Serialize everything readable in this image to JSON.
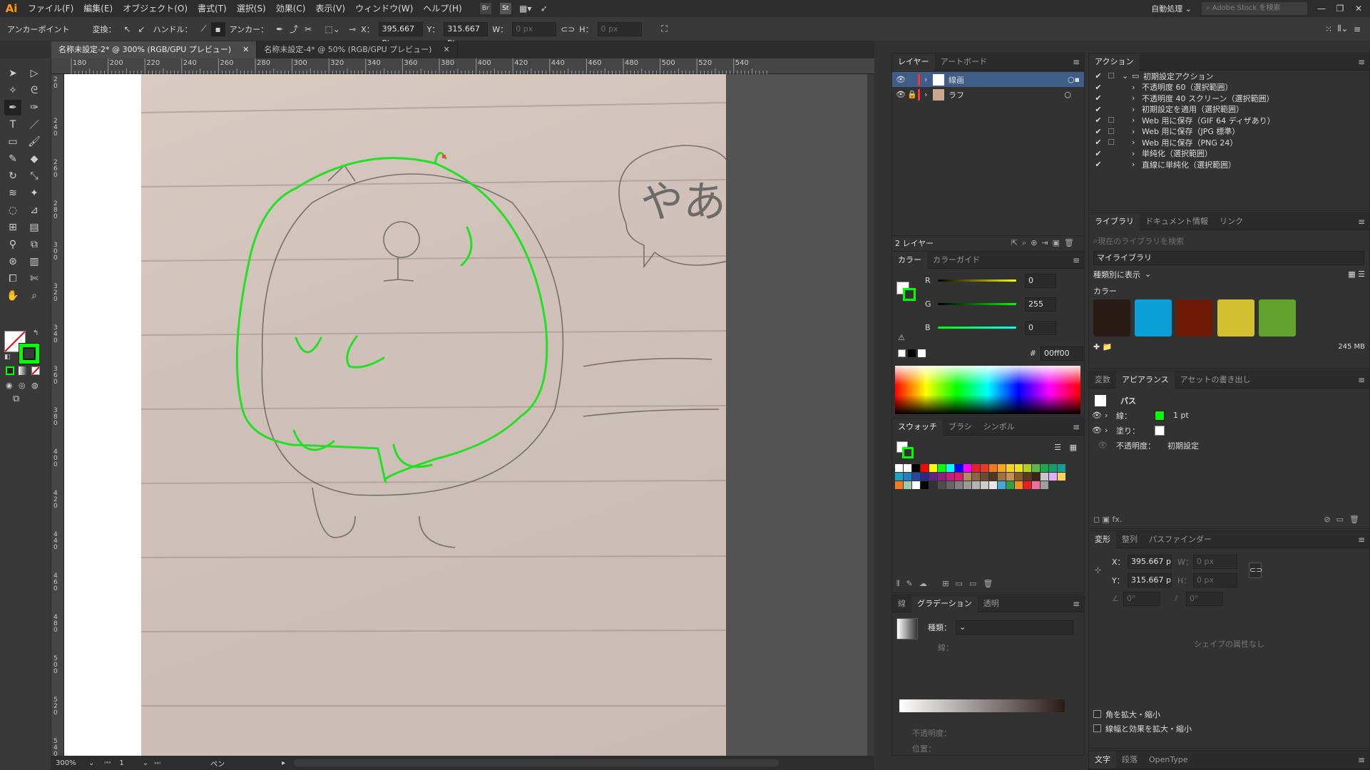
{
  "app": {
    "logo": "Ai",
    "menus": [
      "ファイル(F)",
      "編集(E)",
      "オブジェクト(O)",
      "書式(T)",
      "選択(S)",
      "効果(C)",
      "表示(V)",
      "ウィンドウ(W)",
      "ヘルプ(H)"
    ],
    "workspace": "自動処理",
    "stock_placeholder": "Adobe Stock を検索",
    "st": "St"
  },
  "control": {
    "mode": "アンカーポイント",
    "convert": "変換：",
    "handle": "ハンドル：",
    "anchor": "アンカー：",
    "x_label": "X：",
    "x_value": "395.667 p:",
    "y_label": "Y：",
    "y_value": "315.667 p:",
    "w_label": "W：",
    "w_value": "0 px",
    "h_label": "H：",
    "h_value": "0 px"
  },
  "tabs": [
    {
      "label": "名称未設定-2* @ 300% (RGB/GPU プレビュー)"
    },
    {
      "label": "名称未設定-4* @ 50% (RGB/GPU プレビュー)"
    }
  ],
  "ruler_h": [
    "180",
    "200",
    "220",
    "240",
    "260",
    "280",
    "300",
    "320",
    "340",
    "360",
    "380",
    "400",
    "420",
    "440",
    "460",
    "480",
    "500",
    "520",
    "540"
  ],
  "ruler_v": [
    "2 0",
    "2 4 0",
    "2 6 0",
    "2 8 0",
    "3 0 0",
    "3 2 0",
    "3 4 0",
    "3 6 0",
    "3 8 0",
    "4 0 0",
    "4 2 0",
    "4 4 0",
    "4 6 0",
    "4 8 0",
    "5 0 0",
    "5 2 0",
    "5 4 0"
  ],
  "canvas": {
    "handwriting": "やあ"
  },
  "status": {
    "zoom": "300%",
    "page": "1",
    "tool": "ペン"
  },
  "layers": {
    "tabs": [
      "レイヤー",
      "アートボード"
    ],
    "items": [
      {
        "name": "線画",
        "color": "#ff3030"
      },
      {
        "name": "ラフ",
        "color": "#ff3030"
      }
    ],
    "count": "2 レイヤー"
  },
  "color": {
    "tabs": [
      "カラー",
      "カラーガイド"
    ],
    "r_label": "R",
    "r": "0",
    "g_label": "G",
    "g": "255",
    "b_label": "B",
    "b": "0",
    "hex_label": "#",
    "hex": "00ff00"
  },
  "swatches": {
    "tabs": [
      "スウォッチ",
      "ブラシ",
      "シンボル"
    ],
    "colors": [
      "#ffffff",
      "#ffffff",
      "#000000",
      "#ff0000",
      "#ffff00",
      "#00ff00",
      "#00ffff",
      "#0000ff",
      "#ff00ff",
      "#e8202a",
      "#e63a22",
      "#ef7a1c",
      "#f7a51b",
      "#fbd21c",
      "#e8e41c",
      "#b6d01e",
      "#5cb848",
      "#1ea84a",
      "#169b6c",
      "#12a095",
      "#1ca3c6",
      "#1f7fc2",
      "#244b9b",
      "#2b2a83",
      "#5e2586",
      "#8e1f83",
      "#c51c80",
      "#e21a6d",
      "#b18a60",
      "#8c6440",
      "#6b4b30",
      "#4f3722",
      "#a0723f",
      "#c79057",
      "#8b5a2b",
      "#5a3a1a",
      "#3a2410",
      "#c6c6c6",
      "#e0b0ff",
      "#f9d35e",
      "#f47920",
      "#9ccaae",
      "#ffffff",
      "#000000",
      "#333333",
      "#4d4d4d",
      "#666666",
      "#808080",
      "#999999",
      "#b3b3b3",
      "#cccccc",
      "#e6e6e6",
      "#45a6d6",
      "#2fa13a",
      "#f78f1e",
      "#ed1c24",
      "#ed6fa0",
      "#9e9e9e"
    ]
  },
  "actions": {
    "tab": "アクション",
    "items": [
      "初期設定アクション",
      "不透明度 60（選択範囲）",
      "不透明度 40 スクリーン（選択範囲）",
      "初期設定を適用（選択範囲）",
      "Web 用に保存（GIF 64 ディザあり）",
      "Web 用に保存（JPG 標準）",
      "Web 用に保存（PNG 24）",
      "単純化（選択範囲）",
      "直線に単純化（選択範囲）"
    ]
  },
  "library": {
    "tabs": [
      "ライブラリ",
      "ドキュメント情報",
      "リンク"
    ],
    "search_placeholder": "現在のライブラリを検索",
    "selected": "マイライブラリ",
    "sort": "種類別に表示",
    "section": "カラー",
    "colors": [
      "#2a1a16",
      "#0a9fd6",
      "#6e1a06",
      "#d1c030",
      "#62a32e"
    ],
    "size": "245 MB"
  },
  "appearance": {
    "tabs": [
      "変数",
      "アピアランス",
      "アセットの書き出し"
    ],
    "title": "パス",
    "stroke_label": "線：",
    "stroke_value": "1 pt",
    "fill_label": "塗り：",
    "opacity_label": "不透明度：",
    "opacity_value": "初期設定"
  },
  "transform": {
    "tabs": [
      "変形",
      "整列",
      "パスファインダー"
    ],
    "x_label": "X：",
    "x": "395.667 p",
    "y_label": "Y：",
    "y": "315.667 p",
    "w_label": "W：",
    "w": "0 px",
    "h_label": "H：",
    "h": "0 px",
    "angle": "0°",
    "shear": "0°",
    "no_shape": "シェイプの属性なし",
    "scale_corners": "角を拡大・縮小",
    "scale_strokes": "線幅と効果を拡大・縮小"
  },
  "gradient": {
    "tabs": [
      "線",
      "グラデーション",
      "透明"
    ],
    "type_label": "種類：",
    "stroke_label": "線：",
    "opacity_label": "不透明度：",
    "position_label": "位置："
  },
  "character": {
    "tabs": [
      "文字",
      "段落",
      "OpenType"
    ]
  }
}
